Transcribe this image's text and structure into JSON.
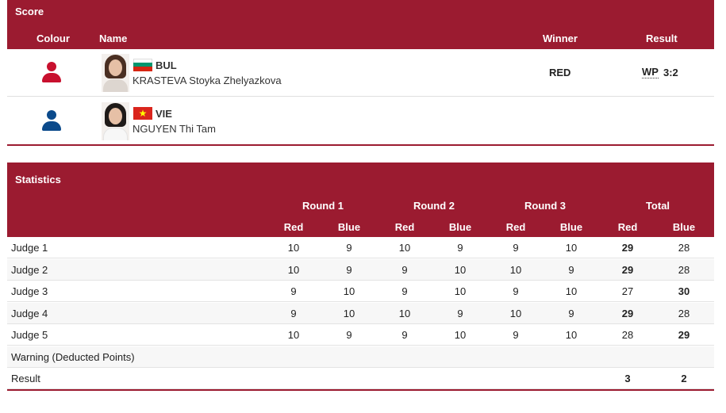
{
  "score": {
    "title": "Score",
    "headers": {
      "colour": "Colour",
      "name": "Name",
      "winner": "Winner",
      "result": "Result"
    },
    "fighters": [
      {
        "corner": "red",
        "noc": "BUL",
        "name": "KRASTEVA Stoyka Zhelyazkova",
        "winner": "RED",
        "result_code": "WP",
        "result_score": "3:2"
      },
      {
        "corner": "blue",
        "noc": "VIE",
        "name": "NGUYEN Thi Tam",
        "winner": "",
        "result_code": "",
        "result_score": ""
      }
    ]
  },
  "statistics": {
    "title": "Statistics",
    "rounds": [
      "Round 1",
      "Round 2",
      "Round 3",
      "Total"
    ],
    "sub": [
      "Red",
      "Blue",
      "Red",
      "Blue",
      "Red",
      "Blue",
      "Red",
      "Blue"
    ],
    "rows": [
      {
        "label": "Judge 1",
        "values": [
          "10",
          "9",
          "10",
          "9",
          "9",
          "10",
          "29",
          "28"
        ],
        "bold": [
          6
        ]
      },
      {
        "label": "Judge 2",
        "values": [
          "10",
          "9",
          "9",
          "10",
          "10",
          "9",
          "29",
          "28"
        ],
        "bold": [
          6
        ]
      },
      {
        "label": "Judge 3",
        "values": [
          "9",
          "10",
          "9",
          "10",
          "9",
          "10",
          "27",
          "30"
        ],
        "bold": [
          7
        ]
      },
      {
        "label": "Judge 4",
        "values": [
          "9",
          "10",
          "10",
          "9",
          "10",
          "9",
          "29",
          "28"
        ],
        "bold": [
          6
        ]
      },
      {
        "label": "Judge 5",
        "values": [
          "10",
          "9",
          "9",
          "10",
          "9",
          "10",
          "28",
          "29"
        ],
        "bold": [
          7
        ]
      },
      {
        "label": "Warning (Deducted Points)",
        "values": [
          "",
          "",
          "",
          "",
          "",
          "",
          "",
          ""
        ],
        "bold": []
      },
      {
        "label": "Result",
        "values": [
          "",
          "",
          "",
          "",
          "",
          "",
          "3",
          "2"
        ],
        "bold": [
          6,
          7
        ]
      }
    ]
  },
  "colors": {
    "header_bg": "#9b1b30",
    "red_corner": "#c8102e",
    "blue_corner": "#0b4a8b"
  }
}
